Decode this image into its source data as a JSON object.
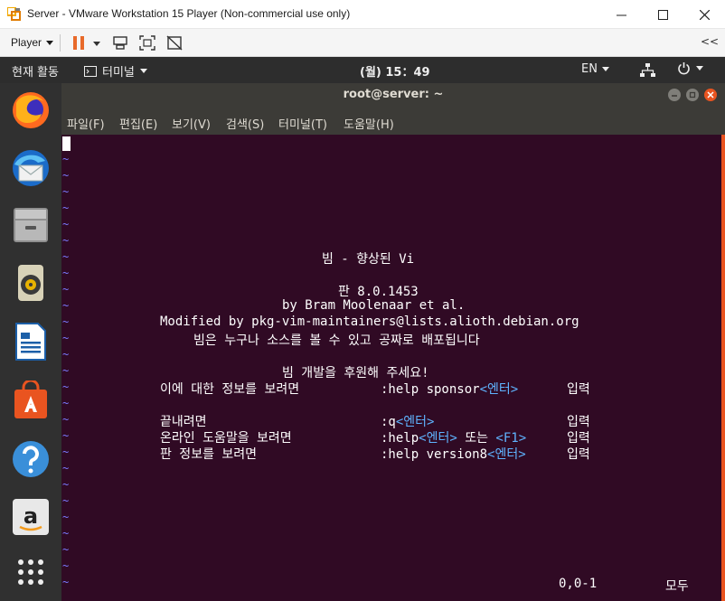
{
  "vmware": {
    "title": "Server - VMware Workstation 15 Player (Non-commercial use only)",
    "player_menu": "Player",
    "collapse": "<<"
  },
  "gnome": {
    "activities": "현재 활동",
    "app_menu": "터미널",
    "clock": "(월) 15：49",
    "lang": "EN"
  },
  "terminal": {
    "title": "root@server: ~",
    "menu": [
      "파일(F)",
      "편집(E)",
      "보기(V)",
      "검색(S)",
      "터미널(T)",
      "도움말(H)"
    ]
  },
  "vim": {
    "tilde": "~",
    "title_line": "빔 - 향상된 Vi",
    "version_line": "판 8.0.1453",
    "author_line": "by Bram Moolenaar et al.",
    "maintainer_line": "Modified by pkg-vim-maintainers@lists.alioth.debian.org",
    "license_line": "빔은 누구나 소스를 볼 수 있고 공짜로 배포됩니다",
    "sponsor_heading": "빔 개발을 후원해 주세요!",
    "rows": [
      {
        "desc": "이에 대한 정보를 보려면",
        "cmd": ":help sponsor",
        "key": "<엔터>",
        "extra": "",
        "extra_key": "",
        "action": "입력"
      },
      {
        "desc": "끝내려면",
        "cmd": ":q",
        "key": "<엔터>",
        "extra": "",
        "extra_key": "",
        "action": "입력"
      },
      {
        "desc": "온라인 도움말을 보려면",
        "cmd": ":help",
        "key": "<엔터>",
        "extra": " 또는 ",
        "extra_key": "<F1>",
        "action": "입력"
      },
      {
        "desc": "판 정보를 보려면",
        "cmd": ":help version8",
        "key": "<엔터>",
        "extra": "",
        "extra_key": "",
        "action": "입력"
      }
    ],
    "cursor_pos": "0,0-1",
    "scroll_pos": "모두"
  },
  "colors": {
    "terminal_bg": "#300a24",
    "accent": "#e95420",
    "tilde": "#7b7bff",
    "special_key": "#5fb4ff"
  },
  "dock_icons": [
    "firefox-icon",
    "thunderbird-icon",
    "files-icon",
    "rhythmbox-icon",
    "writer-icon",
    "software-icon",
    "help-icon",
    "amazon-icon",
    "show-apps-icon"
  ]
}
